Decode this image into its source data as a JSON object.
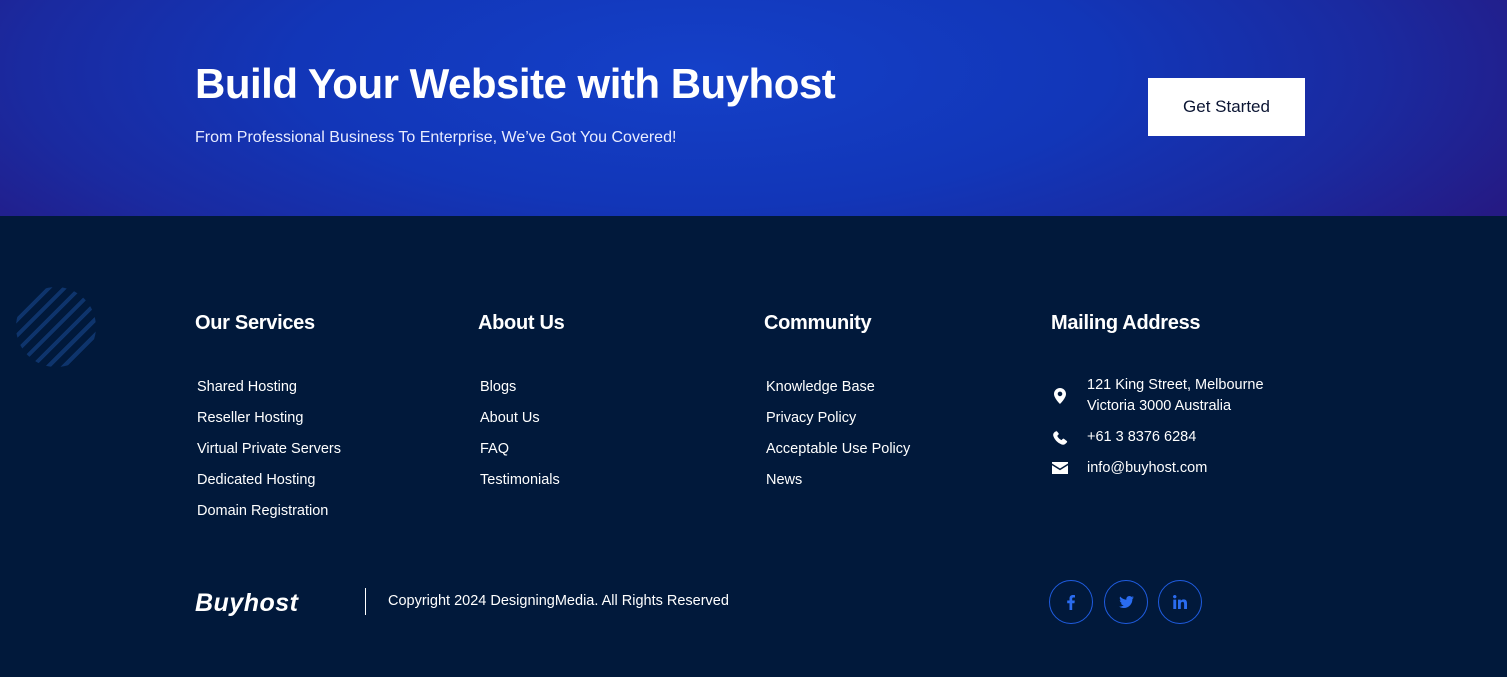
{
  "cta": {
    "title": "Build Your Website with Buyhost",
    "subtitle": "From Professional Business To Enterprise, We’ve Got You Covered!",
    "button_label": "Get Started"
  },
  "footer": {
    "services": {
      "heading": "Our Services",
      "items": [
        "Shared Hosting",
        "Reseller Hosting",
        "Virtual Private Servers",
        "Dedicated Hosting",
        "Domain Registration"
      ]
    },
    "about": {
      "heading": "About Us",
      "items": [
        "Blogs",
        "About Us",
        "FAQ",
        "Testimonials"
      ]
    },
    "community": {
      "heading": "Community",
      "items": [
        "Knowledge Base",
        "Privacy Policy",
        "Acceptable Use Policy",
        "News"
      ]
    },
    "mailing": {
      "heading": "Mailing Address",
      "address_line1": "121 King Street, Melbourne",
      "address_line2": "Victoria 3000 Australia",
      "phone": "+61 3 8376 6284",
      "email": "info@buyhost.com"
    },
    "bottom": {
      "logo": "Buyhost",
      "copyright": "Copyright 2024 DesigningMedia. All Rights Reserved"
    },
    "social": [
      {
        "icon": "facebook-icon"
      },
      {
        "icon": "twitter-icon"
      },
      {
        "icon": "linkedin-icon"
      }
    ]
  },
  "colors": {
    "footer_bg": "#01193b",
    "cta_blue": "#1236b8",
    "social_accent": "#1f5ce0"
  }
}
